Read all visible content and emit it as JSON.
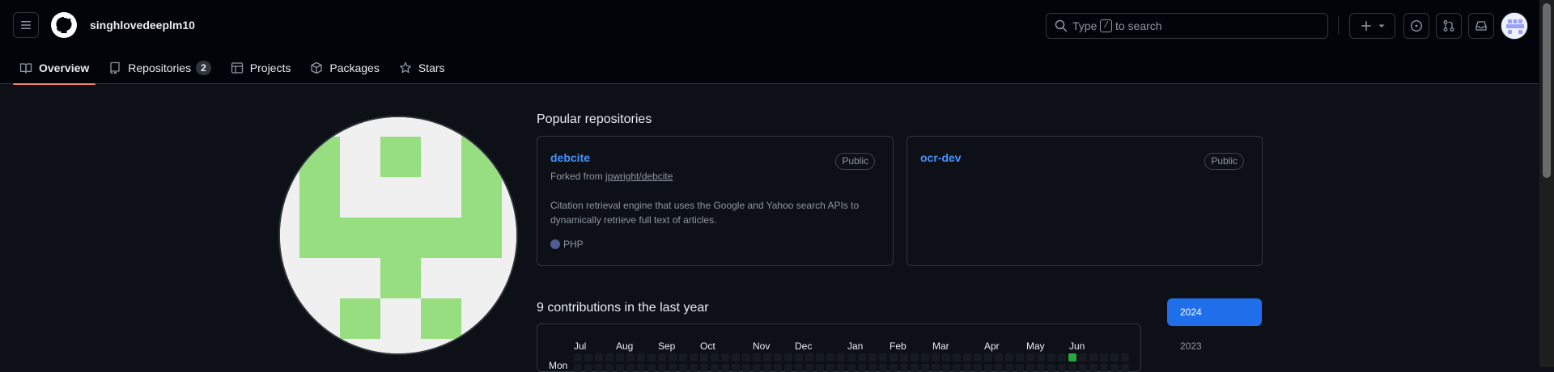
{
  "header": {
    "username": "singhlovedeeplm10",
    "search_prefix": "Type",
    "search_key": "/",
    "search_suffix": "to search"
  },
  "tabs": [
    {
      "label": "Overview",
      "icon": "book-icon",
      "active": true
    },
    {
      "label": "Repositories",
      "icon": "repo-icon",
      "count": "2"
    },
    {
      "label": "Projects",
      "icon": "table-icon"
    },
    {
      "label": "Packages",
      "icon": "package-icon"
    },
    {
      "label": "Stars",
      "icon": "star-icon"
    }
  ],
  "popular": {
    "title": "Popular repositories",
    "repos": [
      {
        "name": "debcite",
        "visibility": "Public",
        "forked_prefix": "Forked from",
        "forked_from": "jpwright/debcite",
        "description": "Citation retrieval engine that uses the Google and Yahoo search APIs to dynamically retrieve full text of articles.",
        "language": "PHP",
        "language_color": "#4f5d95"
      },
      {
        "name": "ocr-dev",
        "visibility": "Public"
      }
    ]
  },
  "contributions": {
    "title": "9 contributions in the last year",
    "months": [
      "Jul",
      "Aug",
      "Sep",
      "Oct",
      "Nov",
      "Dec",
      "Jan",
      "Feb",
      "Mar",
      "Apr",
      "May",
      "Jun"
    ],
    "day_label": "Mon",
    "years": [
      "2024",
      "2023"
    ],
    "selected_year": "2024"
  },
  "colors": {
    "accent": "#1f6feb",
    "link": "#4493f8",
    "tab_underline": "#f78166",
    "contrib_green": "#26a641",
    "avatar_green": "#97de80"
  }
}
